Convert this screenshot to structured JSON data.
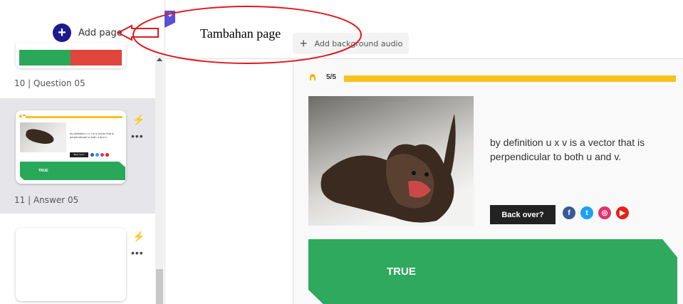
{
  "sidebar": {
    "add_page_label": "Add page",
    "pages": [
      {
        "number_label": "10 | Question 05"
      },
      {
        "number_label": "11 | Answer 05"
      }
    ],
    "thumb": {
      "progress": "5/5",
      "text": "by definition u x v is a vector that is perpendicular to both u and v.",
      "button": "Back over?",
      "banner": "TRUE"
    }
  },
  "annotation": {
    "label": "Tambahan page"
  },
  "toolbar": {
    "audio_label": "Add background audio"
  },
  "slide": {
    "progress_text": "5/5",
    "progress_fraction": 1.0,
    "body_text": "by definition u x v is a vector that is perpendicular to both u and v.",
    "back_button": "Back over?",
    "banner_text": "TRUE",
    "social": [
      {
        "name": "facebook-icon",
        "glyph": "f",
        "color": "#3b5998"
      },
      {
        "name": "twitter-icon",
        "glyph": "t",
        "color": "#1da1f2"
      },
      {
        "name": "instagram-icon",
        "glyph": "◎",
        "color": "#e1306c"
      },
      {
        "name": "youtube-icon",
        "glyph": "▶",
        "color": "#e62117"
      }
    ]
  },
  "colors": {
    "accent": "#1d1a8c",
    "progress": "#f7c21a",
    "banner": "#2ea95e",
    "annotation": "#e0191e"
  }
}
